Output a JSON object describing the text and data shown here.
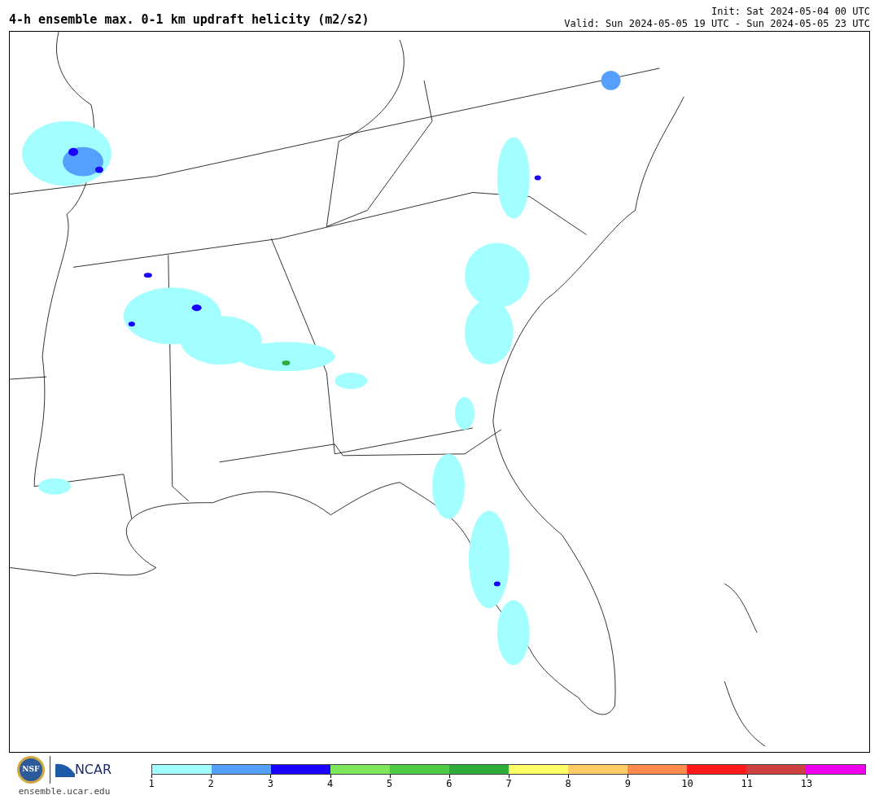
{
  "title": "4-h ensemble max. 0-1 km updraft helicity (m2/s2)",
  "init": "Init: Sat 2024-05-04 00 UTC",
  "valid": "Valid: Sun 2024-05-05 19 UTC - Sun 2024-05-05 23 UTC",
  "logos": {
    "nsf": "NSF",
    "ncar": "NCAR"
  },
  "site": "ensemble.ucar.edu",
  "legend": {
    "segments": [
      {
        "color": "#a3ffff"
      },
      {
        "color": "#55a0ff"
      },
      {
        "color": "#1a00ff"
      },
      {
        "color": "#7ee65b"
      },
      {
        "color": "#4ccc44"
      },
      {
        "color": "#2eae38"
      },
      {
        "color": "#ffff66"
      },
      {
        "color": "#ffcc66"
      },
      {
        "color": "#ff8a4c"
      },
      {
        "color": "#ff1a1a"
      },
      {
        "color": "#cc4040"
      },
      {
        "color": "#ee00ee"
      }
    ],
    "ticks": [
      "1",
      "2",
      "3",
      "4",
      "5",
      "6",
      "7",
      "8",
      "9",
      "10",
      "11",
      "13"
    ]
  }
}
